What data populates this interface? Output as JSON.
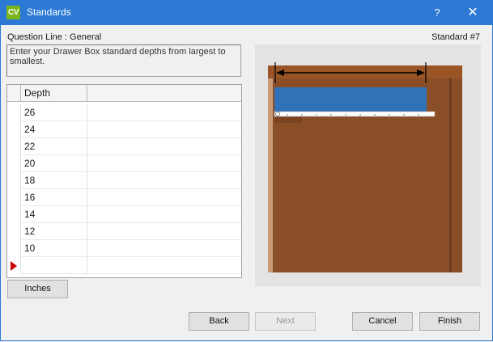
{
  "window": {
    "app_icon_text": "CV",
    "title": "Standards",
    "help_label": "?",
    "close_label": "✕"
  },
  "header": {
    "question_line": "Question Line : General",
    "standard_number": "Standard #7"
  },
  "instruction": "Enter your Drawer Box standard depths from largest to smallest.",
  "grid": {
    "column_header": "Depth",
    "values": [
      "26",
      "24",
      "22",
      "20",
      "18",
      "16",
      "14",
      "12",
      "10"
    ]
  },
  "buttons": {
    "units": "Inches",
    "back": "Back",
    "next": "Next",
    "cancel": "Cancel",
    "finish": "Finish"
  },
  "colors": {
    "titlebar": "#2b79d4",
    "cabinet": "#8b4f27",
    "drawer": "#2f72b8",
    "marker": "#cc0000"
  }
}
